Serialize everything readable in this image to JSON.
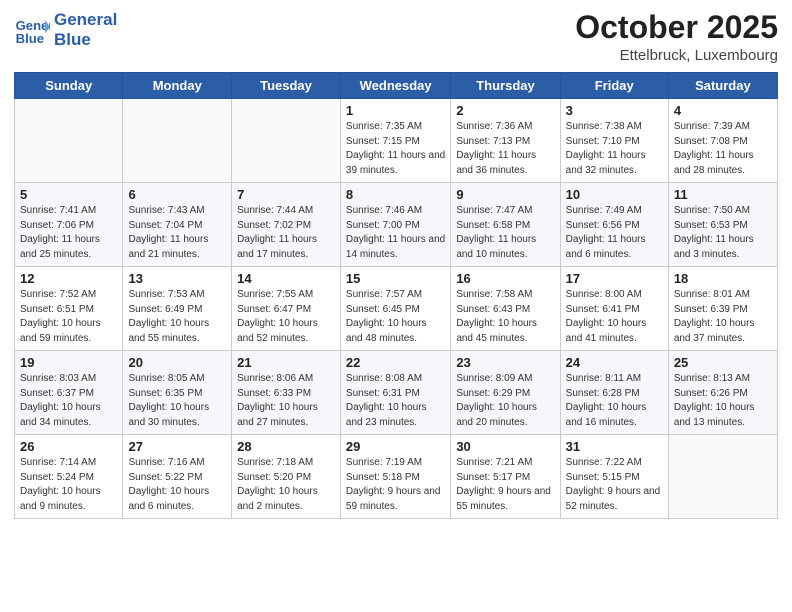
{
  "header": {
    "logo_line1": "General",
    "logo_line2": "Blue",
    "month": "October 2025",
    "location": "Ettelbruck, Luxembourg"
  },
  "weekdays": [
    "Sunday",
    "Monday",
    "Tuesday",
    "Wednesday",
    "Thursday",
    "Friday",
    "Saturday"
  ],
  "weeks": [
    [
      {
        "day": "",
        "info": ""
      },
      {
        "day": "",
        "info": ""
      },
      {
        "day": "",
        "info": ""
      },
      {
        "day": "1",
        "info": "Sunrise: 7:35 AM\nSunset: 7:15 PM\nDaylight: 11 hours\nand 39 minutes."
      },
      {
        "day": "2",
        "info": "Sunrise: 7:36 AM\nSunset: 7:13 PM\nDaylight: 11 hours\nand 36 minutes."
      },
      {
        "day": "3",
        "info": "Sunrise: 7:38 AM\nSunset: 7:10 PM\nDaylight: 11 hours\nand 32 minutes."
      },
      {
        "day": "4",
        "info": "Sunrise: 7:39 AM\nSunset: 7:08 PM\nDaylight: 11 hours\nand 28 minutes."
      }
    ],
    [
      {
        "day": "5",
        "info": "Sunrise: 7:41 AM\nSunset: 7:06 PM\nDaylight: 11 hours\nand 25 minutes."
      },
      {
        "day": "6",
        "info": "Sunrise: 7:43 AM\nSunset: 7:04 PM\nDaylight: 11 hours\nand 21 minutes."
      },
      {
        "day": "7",
        "info": "Sunrise: 7:44 AM\nSunset: 7:02 PM\nDaylight: 11 hours\nand 17 minutes."
      },
      {
        "day": "8",
        "info": "Sunrise: 7:46 AM\nSunset: 7:00 PM\nDaylight: 11 hours\nand 14 minutes."
      },
      {
        "day": "9",
        "info": "Sunrise: 7:47 AM\nSunset: 6:58 PM\nDaylight: 11 hours\nand 10 minutes."
      },
      {
        "day": "10",
        "info": "Sunrise: 7:49 AM\nSunset: 6:56 PM\nDaylight: 11 hours\nand 6 minutes."
      },
      {
        "day": "11",
        "info": "Sunrise: 7:50 AM\nSunset: 6:53 PM\nDaylight: 11 hours\nand 3 minutes."
      }
    ],
    [
      {
        "day": "12",
        "info": "Sunrise: 7:52 AM\nSunset: 6:51 PM\nDaylight: 10 hours\nand 59 minutes."
      },
      {
        "day": "13",
        "info": "Sunrise: 7:53 AM\nSunset: 6:49 PM\nDaylight: 10 hours\nand 55 minutes."
      },
      {
        "day": "14",
        "info": "Sunrise: 7:55 AM\nSunset: 6:47 PM\nDaylight: 10 hours\nand 52 minutes."
      },
      {
        "day": "15",
        "info": "Sunrise: 7:57 AM\nSunset: 6:45 PM\nDaylight: 10 hours\nand 48 minutes."
      },
      {
        "day": "16",
        "info": "Sunrise: 7:58 AM\nSunset: 6:43 PM\nDaylight: 10 hours\nand 45 minutes."
      },
      {
        "day": "17",
        "info": "Sunrise: 8:00 AM\nSunset: 6:41 PM\nDaylight: 10 hours\nand 41 minutes."
      },
      {
        "day": "18",
        "info": "Sunrise: 8:01 AM\nSunset: 6:39 PM\nDaylight: 10 hours\nand 37 minutes."
      }
    ],
    [
      {
        "day": "19",
        "info": "Sunrise: 8:03 AM\nSunset: 6:37 PM\nDaylight: 10 hours\nand 34 minutes."
      },
      {
        "day": "20",
        "info": "Sunrise: 8:05 AM\nSunset: 6:35 PM\nDaylight: 10 hours\nand 30 minutes."
      },
      {
        "day": "21",
        "info": "Sunrise: 8:06 AM\nSunset: 6:33 PM\nDaylight: 10 hours\nand 27 minutes."
      },
      {
        "day": "22",
        "info": "Sunrise: 8:08 AM\nSunset: 6:31 PM\nDaylight: 10 hours\nand 23 minutes."
      },
      {
        "day": "23",
        "info": "Sunrise: 8:09 AM\nSunset: 6:29 PM\nDaylight: 10 hours\nand 20 minutes."
      },
      {
        "day": "24",
        "info": "Sunrise: 8:11 AM\nSunset: 6:28 PM\nDaylight: 10 hours\nand 16 minutes."
      },
      {
        "day": "25",
        "info": "Sunrise: 8:13 AM\nSunset: 6:26 PM\nDaylight: 10 hours\nand 13 minutes."
      }
    ],
    [
      {
        "day": "26",
        "info": "Sunrise: 7:14 AM\nSunset: 5:24 PM\nDaylight: 10 hours\nand 9 minutes."
      },
      {
        "day": "27",
        "info": "Sunrise: 7:16 AM\nSunset: 5:22 PM\nDaylight: 10 hours\nand 6 minutes."
      },
      {
        "day": "28",
        "info": "Sunrise: 7:18 AM\nSunset: 5:20 PM\nDaylight: 10 hours\nand 2 minutes."
      },
      {
        "day": "29",
        "info": "Sunrise: 7:19 AM\nSunset: 5:18 PM\nDaylight: 9 hours\nand 59 minutes."
      },
      {
        "day": "30",
        "info": "Sunrise: 7:21 AM\nSunset: 5:17 PM\nDaylight: 9 hours\nand 55 minutes."
      },
      {
        "day": "31",
        "info": "Sunrise: 7:22 AM\nSunset: 5:15 PM\nDaylight: 9 hours\nand 52 minutes."
      },
      {
        "day": "",
        "info": ""
      }
    ]
  ]
}
